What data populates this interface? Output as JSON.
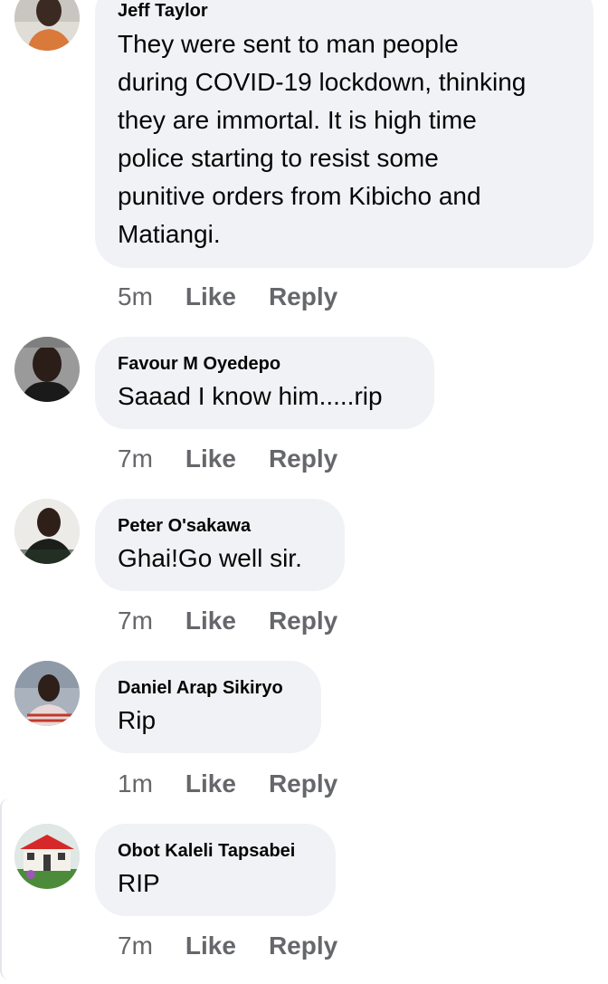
{
  "comments": [
    {
      "author": "Jeff Taylor",
      "text": "They were sent to man people\nduring COVID-19 lockdown, thinking\nthey are immortal. It is high time\npolice starting to resist some\npunitive orders from Kibicho and\nMatiangi.",
      "time": "5m",
      "like": "Like",
      "reply": "Reply",
      "avatar_icon": "user-avatar"
    },
    {
      "author": "Favour M Oyedepo",
      "text": "Saaad I know him.....rip",
      "time": "7m",
      "like": "Like",
      "reply": "Reply",
      "avatar_icon": "user-avatar"
    },
    {
      "author": "Peter O'sakawa",
      "text": "Ghai!Go well sir.",
      "time": "7m",
      "like": "Like",
      "reply": "Reply",
      "avatar_icon": "user-avatar"
    },
    {
      "author": "Daniel Arap Sikiryo",
      "text": "Rip",
      "time": "1m",
      "like": "Like",
      "reply": "Reply",
      "avatar_icon": "user-avatar"
    },
    {
      "author": "Obot Kaleli Tapsabei",
      "text": "RIP",
      "time": "7m",
      "like": "Like",
      "reply": "Reply",
      "avatar_icon": "house-avatar"
    }
  ],
  "colors": {
    "bubble": "#f0f2f5",
    "text": "#050505",
    "meta": "#65676b"
  }
}
